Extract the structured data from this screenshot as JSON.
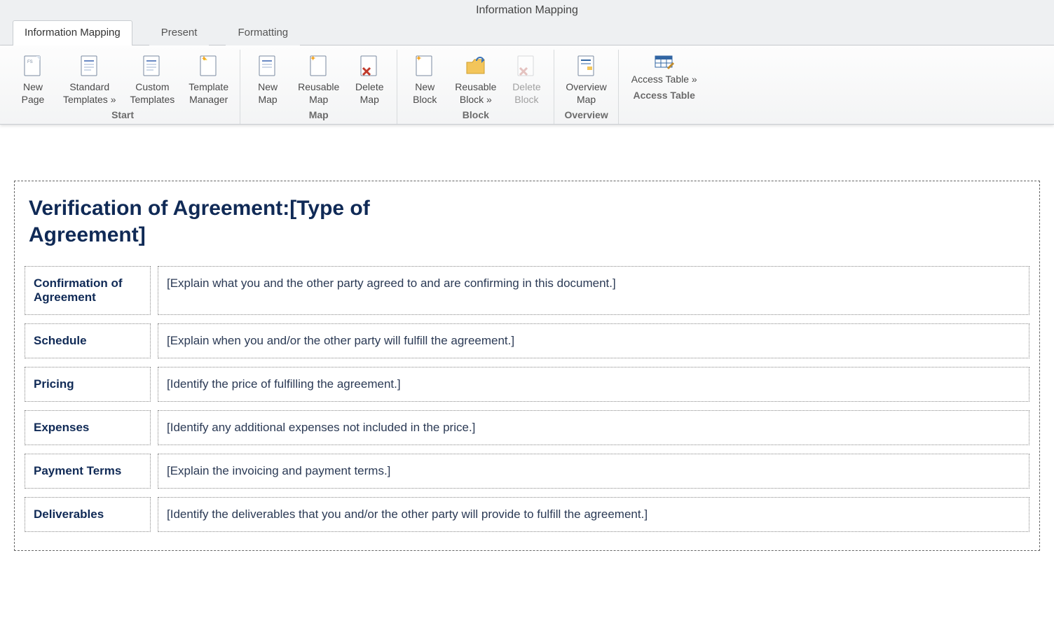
{
  "app_title": "Information Mapping",
  "tabs": [
    {
      "label": "Information Mapping",
      "active": true
    },
    {
      "label": "Present",
      "active": false
    },
    {
      "label": "Formatting",
      "active": false
    }
  ],
  "ribbon": {
    "start": {
      "label": "Start",
      "buttons": [
        {
          "line1": "New",
          "line2": "Page",
          "icon": "page-new"
        },
        {
          "line1": "Standard",
          "line2": "Templates »",
          "icon": "page-lines"
        },
        {
          "line1": "Custom",
          "line2": "Templates",
          "icon": "page-lines"
        },
        {
          "line1": "Template",
          "line2": "Manager",
          "icon": "page-star"
        }
      ]
    },
    "map": {
      "label": "Map",
      "buttons": [
        {
          "line1": "New",
          "line2": "Map",
          "icon": "page-lines"
        },
        {
          "line1": "Reusable",
          "line2": "Map",
          "icon": "page-star"
        },
        {
          "line1": "Delete",
          "line2": "Map",
          "icon": "page-delete"
        }
      ]
    },
    "block": {
      "label": "Block",
      "buttons": [
        {
          "line1": "New",
          "line2": "Block",
          "icon": "page-star-blank"
        },
        {
          "line1": "Reusable",
          "line2": "Block »",
          "icon": "folder"
        },
        {
          "line1": "Delete",
          "line2": "Block",
          "icon": "page-delete",
          "disabled": true
        }
      ]
    },
    "overview": {
      "label": "Overview",
      "buttons": [
        {
          "line1": "Overview",
          "line2": "Map",
          "icon": "page-lines-color"
        }
      ]
    },
    "access": {
      "label": "Access Table",
      "button_label": "Access Table »",
      "icon": "table-edit"
    }
  },
  "document": {
    "title": "Verification of Agreement:[Type of Agreement]",
    "rows": [
      {
        "label": "Confirmation of Agreement",
        "value": "[Explain what you and the other party agreed to and are confirming in this document.]"
      },
      {
        "label": "Schedule",
        "value": "[Explain when you and/or the other party will fulfill the agreement.]"
      },
      {
        "label": "Pricing",
        "value": "[Identify the price of fulfilling the agreement.]"
      },
      {
        "label": "Expenses",
        "value": "[Identify any additional expenses not included in the price.]"
      },
      {
        "label": "Payment Terms",
        "value": "[Explain the invoicing and payment terms.]"
      },
      {
        "label": "Deliverables",
        "value": "[Identify the deliverables that you and/or the other party will provide to fulfill the agreement.]"
      }
    ]
  }
}
